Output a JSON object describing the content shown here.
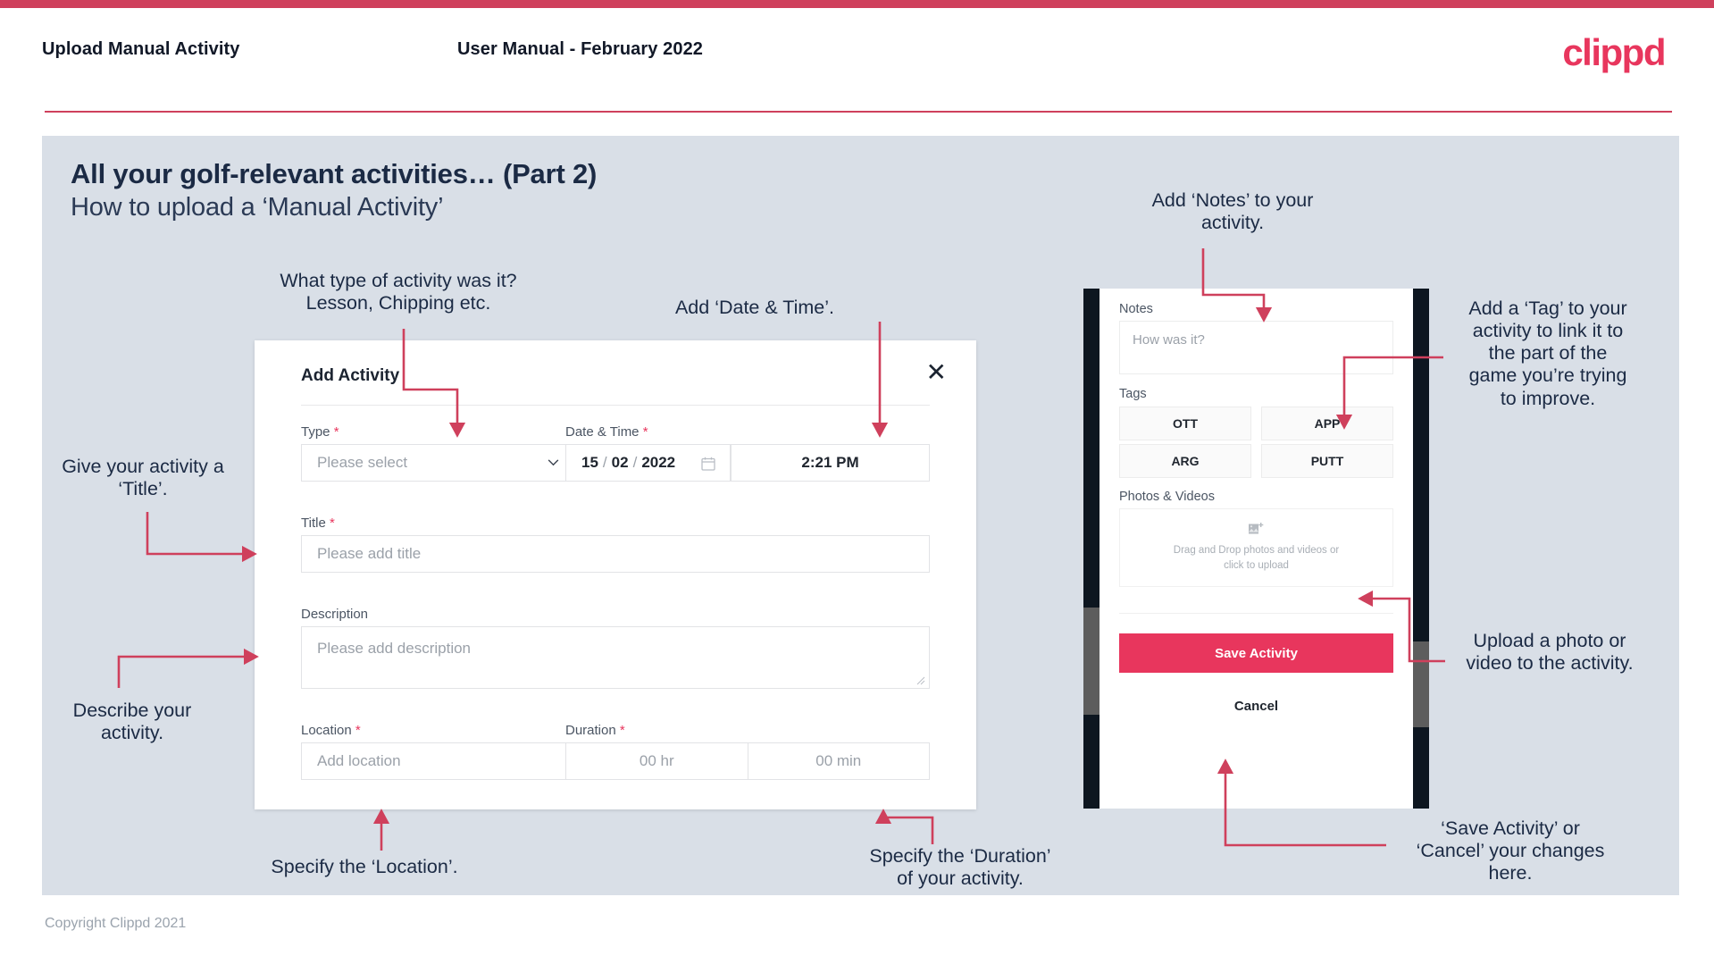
{
  "header": {
    "title": "Upload Manual Activity",
    "subtitle": "User Manual - February 2022",
    "logo": "clippd"
  },
  "slide": {
    "title": "All your golf-relevant activities… (Part 2)",
    "subtitle": "How to upload a ‘Manual Activity’"
  },
  "footer": {
    "copyright": "Copyright Clippd 2021"
  },
  "dialog": {
    "title": "Add Activity",
    "close_icon": "close-icon",
    "fields": {
      "type": {
        "label": "Type",
        "required": "*",
        "placeholder": "Please select",
        "chevron_icon": "chevron-down-icon"
      },
      "datetime": {
        "label": "Date & Time",
        "required": "*",
        "day": "15",
        "sep1": "/",
        "month": "02",
        "sep2": "/",
        "year": "2022",
        "calendar_icon": "calendar-icon",
        "time": "2:21 PM"
      },
      "title": {
        "label": "Title",
        "required": "*",
        "placeholder": "Please add title"
      },
      "description": {
        "label": "Description",
        "required": "",
        "placeholder": "Please add description"
      },
      "location": {
        "label": "Location",
        "required": "*",
        "placeholder": "Add location"
      },
      "duration": {
        "label": "Duration",
        "required": "*",
        "hours_placeholder": "00 hr",
        "minutes_placeholder": "00 min"
      }
    }
  },
  "phone": {
    "notes": {
      "label": "Notes",
      "placeholder": "How was it?"
    },
    "tags": {
      "label": "Tags",
      "items": [
        "OTT",
        "APP",
        "ARG",
        "PUTT"
      ]
    },
    "photos": {
      "label": "Photos & Videos",
      "icon": "add-image-icon",
      "line1": "Drag and Drop photos and videos or",
      "line2": "click to upload"
    },
    "save_label": "Save Activity",
    "cancel_label": "Cancel"
  },
  "annotations": {
    "type": "What type of activity was it?\nLesson, Chipping etc.",
    "datetime": "Add ‘Date & Time’.",
    "title": "Give your activity a\n‘Title’.",
    "description": "Describe your\nactivity.",
    "location": "Specify the ‘Location’.",
    "duration": "Specify the ‘Duration’\nof your activity.",
    "notes": "Add ‘Notes’ to your\nactivity.",
    "tags": "Add a ‘Tag’ to your\nactivity to link it to\nthe part of the\ngame you’re trying\nto improve.",
    "upload": "Upload a photo or\nvideo to the activity.",
    "save": "‘Save Activity’ or\n‘Cancel’ your changes\nhere."
  },
  "colors": {
    "brand": "#e8365d",
    "bar": "#cf405c",
    "slide_bg": "#d9dfe7",
    "text_dark": "#1b2a44",
    "arrow": "#cf405c"
  }
}
